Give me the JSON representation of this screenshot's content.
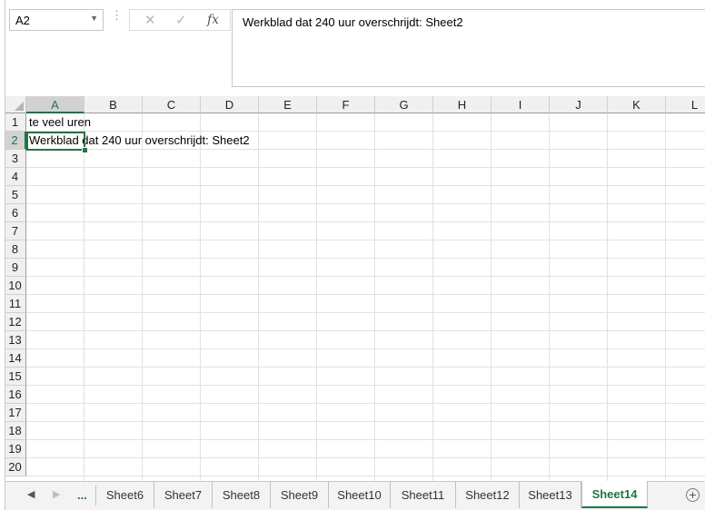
{
  "name_box": {
    "value": "A2"
  },
  "formula_bar": {
    "cancel_icon": "x-icon",
    "enter_icon": "check-icon",
    "fx_label": "fx",
    "value": "Werkblad dat 240 uur overschrijdt: Sheet2"
  },
  "columns": [
    "A",
    "B",
    "C",
    "D",
    "E",
    "F",
    "G",
    "H",
    "I",
    "J",
    "K",
    "L"
  ],
  "rows": [
    "1",
    "2",
    "3",
    "4",
    "5",
    "6",
    "7",
    "8",
    "9",
    "10",
    "11",
    "12",
    "13",
    "14",
    "15",
    "16",
    "17",
    "18",
    "19",
    "20"
  ],
  "cells": {
    "A1": "te veel uren",
    "A2": "Werkblad dat 240 uur overschrijdt: Sheet2"
  },
  "selected_cell": "A2",
  "sheet_nav": {
    "prev_icon": "triangle-left-icon",
    "next_icon": "triangle-right-icon",
    "more": "..."
  },
  "sheets": [
    "Sheet6",
    "Sheet7",
    "Sheet8",
    "Sheet9",
    "Sheet10",
    "Sheet11",
    "Sheet12",
    "Sheet13",
    "Sheet14"
  ],
  "active_sheet": "Sheet14",
  "accent_color": "#217346"
}
